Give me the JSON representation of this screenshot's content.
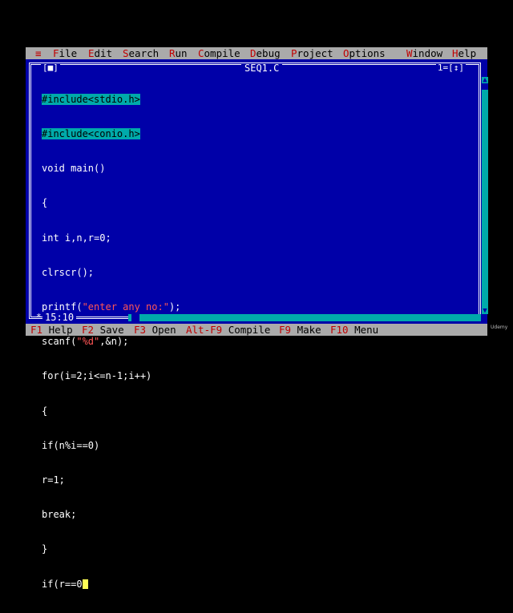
{
  "menu": {
    "system": "≡",
    "items": [
      {
        "hot": "F",
        "rest": "ile"
      },
      {
        "hot": "E",
        "rest": "dit"
      },
      {
        "hot": "S",
        "rest": "earch"
      },
      {
        "hot": "R",
        "rest": "un"
      },
      {
        "hot": "C",
        "rest": "ompile"
      },
      {
        "hot": "D",
        "rest": "ebug"
      },
      {
        "hot": "P",
        "rest": "roject"
      },
      {
        "hot": "O",
        "rest": "ptions"
      },
      {
        "hot": "W",
        "rest": "indow"
      },
      {
        "hot": "H",
        "rest": "elp"
      }
    ]
  },
  "editor": {
    "close_box": "[■]",
    "title": "SEQ1.C",
    "window_number": "1=[↕]",
    "lines": [
      "#include<stdio.h>",
      "#include<conio.h>",
      "void main()",
      "{",
      "int i,n,r=0;",
      "clrscr();",
      "printf(\"enter any no:\");",
      "scanf(\"%d\",&n);",
      "for(i=2;i<=n-1;i++)",
      "{",
      "if(n%i==0)",
      "r=1;",
      "break;",
      "}",
      "if(r==0"
    ],
    "cursor_position": "15:10",
    "modified_marker": "*"
  },
  "status": {
    "items": [
      {
        "key": "F1",
        "label": "Help"
      },
      {
        "key": "F2",
        "label": "Save"
      },
      {
        "key": "F3",
        "label": "Open"
      },
      {
        "key": "Alt-F9",
        "label": "Compile"
      },
      {
        "key": "F9",
        "label": "Make"
      },
      {
        "key": "F10",
        "label": "Menu"
      }
    ]
  },
  "watermark": "Udemy",
  "colors": {
    "editor_bg": "#0000a8",
    "menu_bg": "#aaaaaa",
    "hotkey": "#c00000",
    "preprocessor_bg": "#00aaaa",
    "string": "#ff5555",
    "cursor": "#ffff55"
  }
}
